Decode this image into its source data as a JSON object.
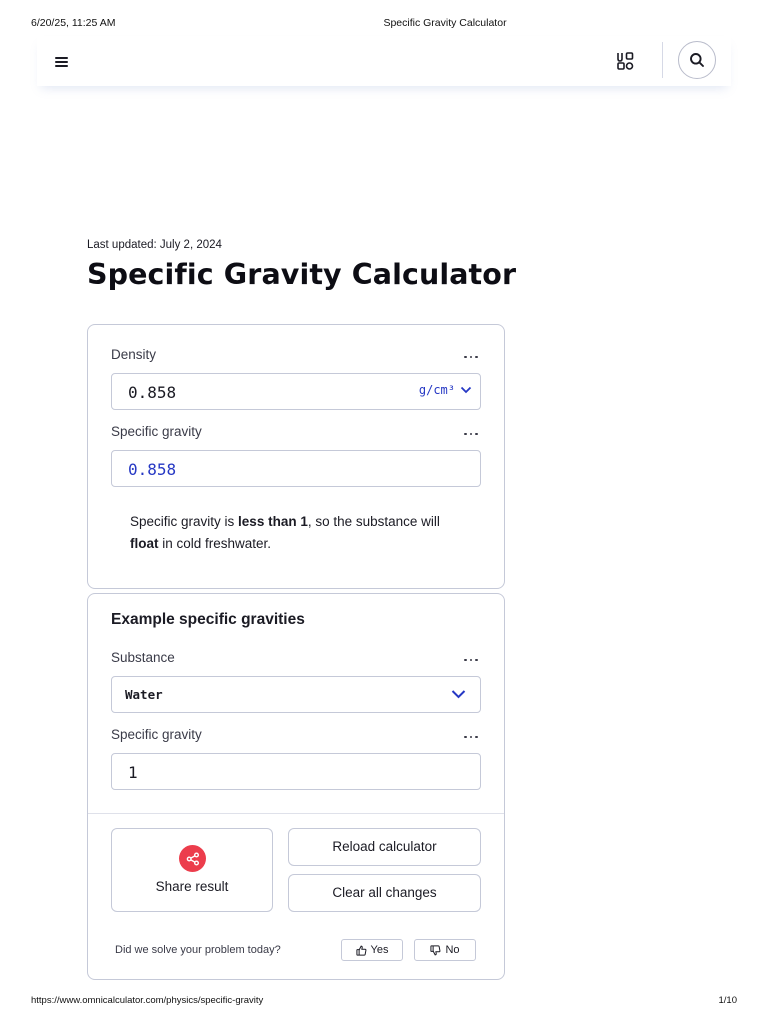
{
  "print_header": {
    "datetime": "6/20/25, 11:25 AM",
    "title": "Specific Gravity Calculator"
  },
  "navbar": {
    "menu_icon": "hamburger-menu-icon",
    "categories_icon": "grid-categories-icon",
    "search_icon": "search-icon"
  },
  "page": {
    "last_updated_label": "Last updated:",
    "last_updated_date": "July 2, 2024",
    "title": "Specific Gravity Calculator"
  },
  "calculator": {
    "density": {
      "label": "Density",
      "value": "0.858",
      "unit": "g/cm³"
    },
    "specific_gravity": {
      "label": "Specific gravity",
      "value": "0.858"
    },
    "result": {
      "part1": "Specific gravity is ",
      "emphasis1": "less than 1",
      "part2": ", so the substance will ",
      "emphasis2": "float",
      "part3": " in cold freshwater."
    }
  },
  "examples": {
    "title": "Example specific gravities",
    "substance_label": "Substance",
    "substance_value": "Water",
    "specific_gravity_label": "Specific gravity",
    "specific_gravity_value": "1"
  },
  "actions": {
    "share_label": "Share result",
    "reload_label": "Reload calculator",
    "clear_label": "Clear all changes"
  },
  "feedback": {
    "question": "Did we solve your problem today?",
    "yes_label": "Yes",
    "no_label": "No"
  },
  "colors": {
    "accent_blue": "#2638c4",
    "share_red": "#ec3d4c",
    "border": "#c5c9d8"
  },
  "print_footer": {
    "url": "https://www.omnicalculator.com/physics/specific-gravity",
    "page": "1/10"
  }
}
